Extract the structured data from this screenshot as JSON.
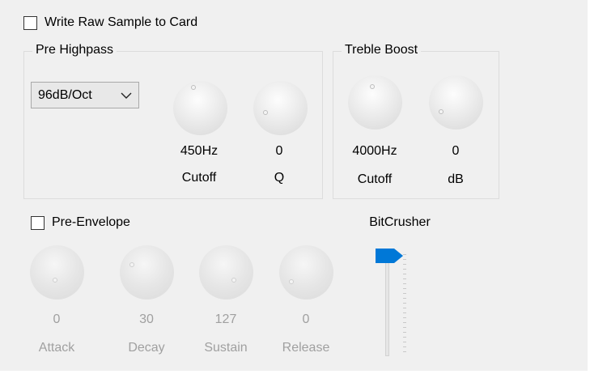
{
  "write_raw": {
    "label": "Write Raw Sample to Card",
    "checked": false
  },
  "pre_highpass": {
    "title": "Pre Highpass",
    "slope": {
      "value": "96dB/Oct",
      "icon": "chevron-down-icon"
    },
    "knobs": [
      {
        "value": "450Hz",
        "label": "Cutoff"
      },
      {
        "value": "0",
        "label": "Q"
      }
    ]
  },
  "treble_boost": {
    "title": "Treble Boost",
    "knobs": [
      {
        "value": "4000Hz",
        "label": "Cutoff"
      },
      {
        "value": "0",
        "label": "dB"
      }
    ]
  },
  "pre_envelope": {
    "label": "Pre-Envelope",
    "checked": false,
    "knobs": [
      {
        "value": "0",
        "label": "Attack"
      },
      {
        "value": "30",
        "label": "Decay"
      },
      {
        "value": "127",
        "label": "Sustain"
      },
      {
        "value": "0",
        "label": "Release"
      }
    ]
  },
  "bitcrusher": {
    "label": "BitCrusher",
    "level": 1.0
  },
  "colors": {
    "background": "#f0f0f0",
    "thumb": "#0078d7",
    "disabled_text": "#a0a0a0"
  }
}
